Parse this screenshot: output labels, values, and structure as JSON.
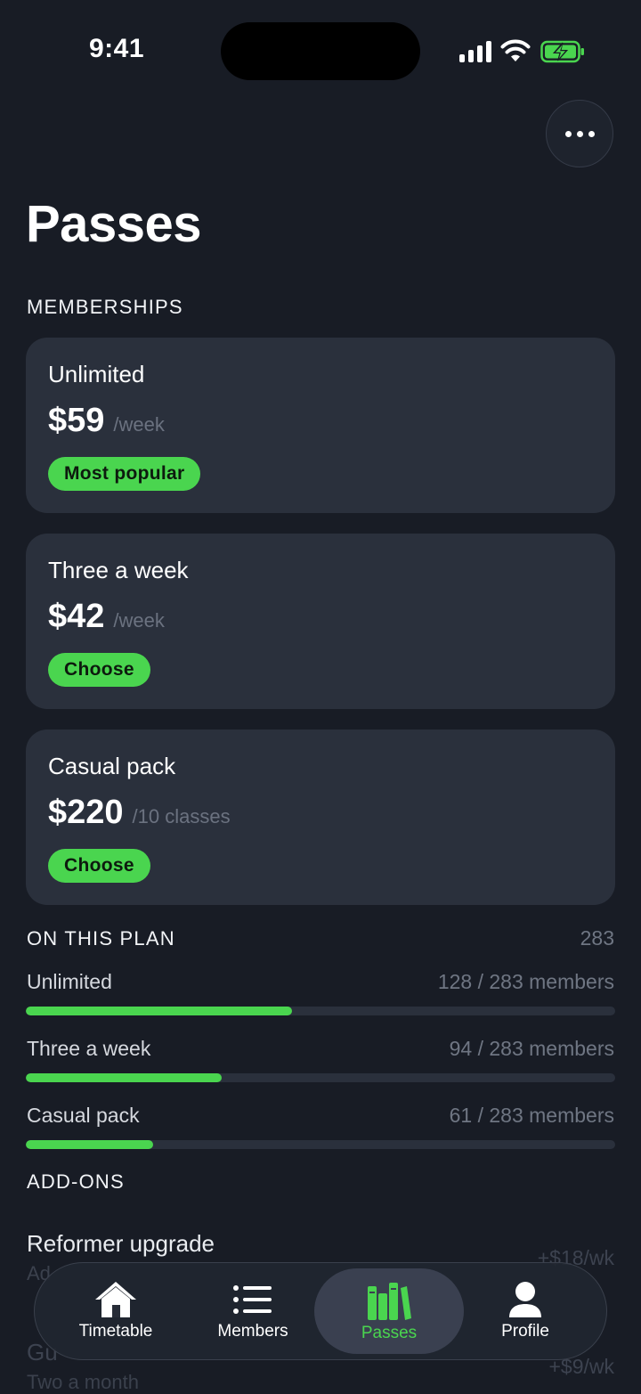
{
  "status_bar": {
    "time": "9:41"
  },
  "page": {
    "title": "Passes"
  },
  "memberships": {
    "heading": "MEMBERSHIPS",
    "plans": [
      {
        "name": "Unlimited",
        "price": "$59",
        "unit": "/week",
        "action": "Most popular"
      },
      {
        "name": "Three a week",
        "price": "$42",
        "unit": "/week",
        "action": "Choose"
      },
      {
        "name": "Casual pack",
        "price": "$220",
        "unit": "/10 classes",
        "action": "Choose"
      }
    ]
  },
  "on_this_plan": {
    "heading": "ON THIS PLAN",
    "total": "283",
    "rows": [
      {
        "label": "Unlimited",
        "count": "128 / 283 members",
        "fraction": 0.452
      },
      {
        "label": "Three a week",
        "count": "94 / 283 members",
        "fraction": 0.332
      },
      {
        "label": "Casual pack",
        "count": "61 / 283 members",
        "fraction": 0.216
      }
    ]
  },
  "add_ons": {
    "heading": "ADD-ONS",
    "items": [
      {
        "name": "Reformer upgrade",
        "desc": "Ad",
        "price": "+$18/wk"
      },
      {
        "name": "Gu",
        "desc": "Two a month",
        "price": "+$9/wk"
      }
    ]
  },
  "tabs": [
    {
      "label": "Timetable",
      "icon": "house-icon",
      "active": false
    },
    {
      "label": "Members",
      "icon": "list-icon",
      "active": false
    },
    {
      "label": "Passes",
      "icon": "books-icon",
      "active": true
    },
    {
      "label": "Profile",
      "icon": "person-icon",
      "active": false
    }
  ],
  "colors": {
    "background": "#181c25",
    "card": "#2a303c",
    "accent": "#4ad54f"
  }
}
